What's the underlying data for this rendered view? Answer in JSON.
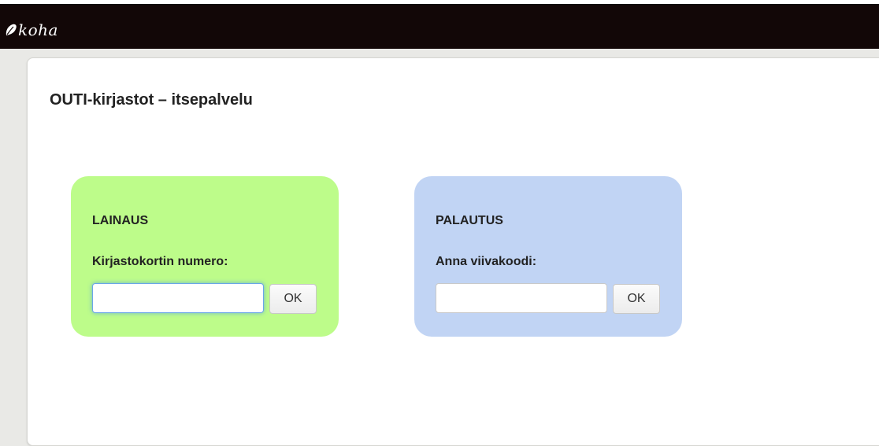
{
  "header": {
    "logo_text": "koha",
    "logo_icon": "koha-leaf-icon",
    "background_color": "#120707"
  },
  "main": {
    "title": "OUTI-kirjastot – itsepalvelu"
  },
  "checkout": {
    "title": "LAINAUS",
    "field_label": "Kirjastokortin numero:",
    "input_value": "",
    "button_label": "OK",
    "color": "#bdfc8a"
  },
  "checkin": {
    "title": "PALAUTUS",
    "field_label": "Anna viivakoodi:",
    "input_value": "",
    "button_label": "OK",
    "color": "#c1d4f4"
  }
}
